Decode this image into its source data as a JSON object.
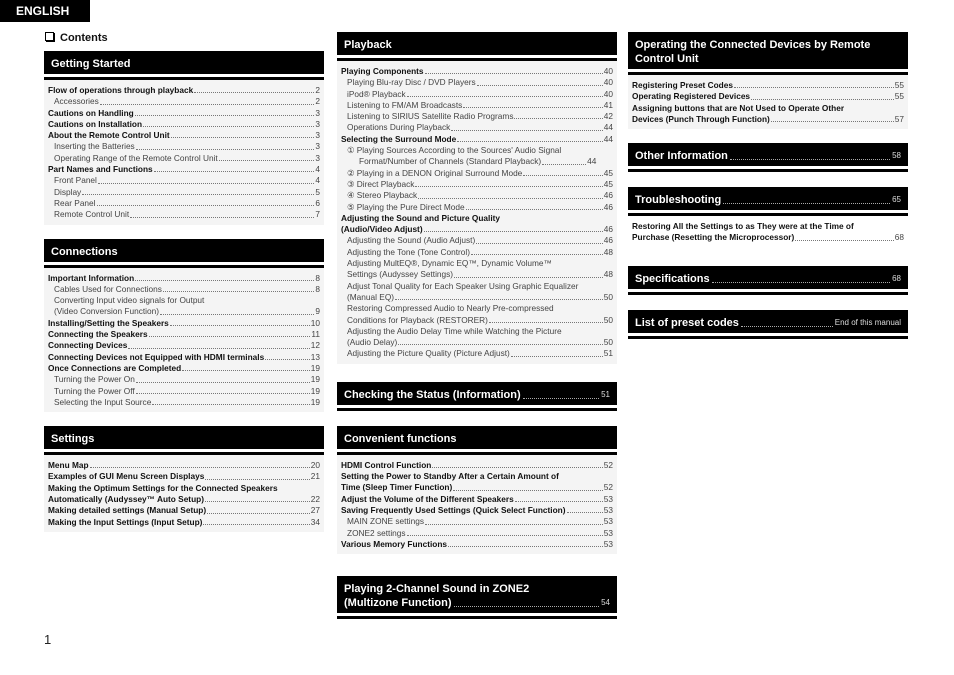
{
  "language_tab": "ENGLISH",
  "contents_title": "Contents",
  "page_number": "1",
  "columns": {
    "col1": {
      "getting_started": {
        "title": "Getting Started",
        "items": [
          {
            "text": "Flow of operations through playback",
            "page": "2",
            "bold": true
          },
          {
            "text": "Accessories",
            "page": "2",
            "bold": false
          },
          {
            "text": "Cautions on Handling",
            "page": "3",
            "bold": true
          },
          {
            "text": "Cautions on Installation",
            "page": "3",
            "bold": true
          },
          {
            "text": "About the Remote Control Unit",
            "page": "3",
            "bold": true
          },
          {
            "text": "Inserting the Batteries",
            "page": "3",
            "bold": false
          },
          {
            "text": "Operating Range of the Remote Control Unit",
            "page": "3",
            "bold": false
          },
          {
            "text": "Part Names and Functions",
            "page": "4",
            "bold": true
          },
          {
            "text": "Front Panel",
            "page": "4",
            "bold": false
          },
          {
            "text": "Display",
            "page": "5",
            "bold": false
          },
          {
            "text": "Rear Panel",
            "page": "6",
            "bold": false
          },
          {
            "text": "Remote Control Unit",
            "page": "7",
            "bold": false
          }
        ]
      },
      "connections": {
        "title": "Connections",
        "items": [
          {
            "text": "Important Information",
            "page": "8",
            "bold": true
          },
          {
            "text": "Cables Used for Connections",
            "page": "8",
            "bold": false
          },
          {
            "text": "Converting Input video signals for Output",
            "page": "",
            "bold": false
          },
          {
            "text": "(Video Conversion Function)",
            "page": "9",
            "bold": false
          },
          {
            "text": "Installing/Setting the Speakers",
            "page": "10",
            "bold": true
          },
          {
            "text": "Connecting the Speakers",
            "page": "11",
            "bold": true
          },
          {
            "text": "Connecting Devices",
            "page": "12",
            "bold": true
          },
          {
            "text": "Connecting Devices not Equipped with HDMI terminals",
            "page": "13",
            "bold": true
          },
          {
            "text": "Once Connections are Completed",
            "page": "19",
            "bold": true
          },
          {
            "text": "Turning the Power On",
            "page": "19",
            "bold": false
          },
          {
            "text": "Turning the Power Off",
            "page": "19",
            "bold": false
          },
          {
            "text": "Selecting the Input Source",
            "page": "19",
            "bold": false
          }
        ]
      },
      "settings": {
        "title": "Settings",
        "items": [
          {
            "text": "Menu Map",
            "page": "20",
            "bold": true
          },
          {
            "text": "Examples of GUI Menu Screen Displays",
            "page": "21",
            "bold": true
          },
          {
            "text": "Making the Optimum Settings for the Connected Speakers",
            "page": "",
            "bold": true
          },
          {
            "text": "Automatically (Audyssey™ Auto Setup)",
            "page": "22",
            "bold": true
          },
          {
            "text": "Making detailed settings (Manual Setup)",
            "page": "27",
            "bold": true
          },
          {
            "text": "Making the Input Settings (Input Setup)",
            "page": "34",
            "bold": true
          }
        ]
      }
    },
    "col2": {
      "playback": {
        "title": "Playback",
        "items": [
          {
            "text": "Playing Components",
            "page": "40",
            "bold": true
          },
          {
            "text": "Playing Blu-ray Disc / DVD Players",
            "page": "40",
            "bold": false
          },
          {
            "text": "iPod® Playback",
            "page": "40",
            "bold": false
          },
          {
            "text": "Listening to FM/AM Broadcasts",
            "page": "41",
            "bold": false
          },
          {
            "text": "Listening to SIRIUS Satellite Radio Programs",
            "page": "42",
            "bold": false
          },
          {
            "text": "Operations During Playback",
            "page": "44",
            "bold": false
          },
          {
            "text": "Selecting the Surround Mode",
            "page": "44",
            "bold": true
          },
          {
            "text": "① Playing Sources According to the Sources' Audio Signal",
            "page": "",
            "bold": false
          },
          {
            "text": "Format/Number of Channels (Standard Playback)",
            "page": "44",
            "bold": false,
            "indent2": true,
            "short": true
          },
          {
            "text": "② Playing in a DENON Original Surround Mode",
            "page": "45",
            "bold": false
          },
          {
            "text": "③ Direct Playback",
            "page": "45",
            "bold": false
          },
          {
            "text": "④ Stereo Playback",
            "page": "46",
            "bold": false
          },
          {
            "text": "⑤ Playing the Pure Direct Mode",
            "page": "46",
            "bold": false
          },
          {
            "text": "Adjusting the Sound and Picture Quality",
            "page": "",
            "bold": true
          },
          {
            "text": "(Audio/Video Adjust)",
            "page": "46",
            "bold": true
          },
          {
            "text": "Adjusting the Sound (Audio Adjust)",
            "page": "46",
            "bold": false
          },
          {
            "text": "Adjusting the Tone (Tone Control)",
            "page": "48",
            "bold": false
          },
          {
            "text": "Adjusting MultEQ®, Dynamic EQ™, Dynamic Volume™",
            "page": "",
            "bold": false
          },
          {
            "text": "Settings (Audyssey Settings)",
            "page": "48",
            "bold": false
          },
          {
            "text": "Adjust Tonal Quality for Each Speaker Using Graphic Equalizer",
            "page": "",
            "bold": false
          },
          {
            "text": "(Manual EQ)",
            "page": "50",
            "bold": false
          },
          {
            "text": "Restoring Compressed Audio to Nearly Pre-compressed",
            "page": "",
            "bold": false
          },
          {
            "text": "Conditions for Playback (RESTORER)",
            "page": "50",
            "bold": false
          },
          {
            "text": "Adjusting the Audio Delay Time while Watching the Picture",
            "page": "",
            "bold": false
          },
          {
            "text": "(Audio Delay)",
            "page": "50",
            "bold": false
          },
          {
            "text": "Adjusting the Picture Quality (Picture Adjust)",
            "page": "51",
            "bold": false
          }
        ]
      },
      "checking_status": {
        "title": "Checking the Status (Information)",
        "page": "51"
      },
      "convenient": {
        "title": "Convenient functions",
        "items": [
          {
            "text": "HDMI Control Function",
            "page": "52",
            "bold": true
          },
          {
            "text": "Setting the Power to Standby After a Certain Amount of",
            "page": "",
            "bold": true
          },
          {
            "text": "Time (Sleep Timer Function)",
            "page": "52",
            "bold": true
          },
          {
            "text": "Adjust the Volume of the Different Speakers",
            "page": "53",
            "bold": true
          },
          {
            "text": "Saving Frequently Used Settings (Quick Select Function)",
            "page": "53",
            "bold": true
          },
          {
            "text": "MAIN ZONE settings",
            "page": "53",
            "bold": false
          },
          {
            "text": "ZONE2 settings",
            "page": "53",
            "bold": false
          },
          {
            "text": "Various Memory Functions",
            "page": "53",
            "bold": true
          }
        ]
      },
      "zone2": {
        "title_line1": "Playing 2-Channel Sound in ZONE2",
        "title_line2": "(Multizone Function)",
        "page": "54"
      }
    },
    "col3": {
      "operating": {
        "title": "Operating the Connected Devices by Remote Control Unit",
        "items": [
          {
            "text": "Registering Preset Codes",
            "page": "55",
            "bold": true
          },
          {
            "text": "Operating Registered Devices",
            "page": "55",
            "bold": true
          },
          {
            "text": "Assigning buttons that are Not Used to Operate Other",
            "page": "",
            "bold": true
          },
          {
            "text": "Devices (Punch Through Function)",
            "page": "57",
            "bold": true
          }
        ]
      },
      "other_info": {
        "title": "Other Information",
        "page": "58"
      },
      "troubleshooting": {
        "title": "Troubleshooting",
        "page": "65",
        "items": [
          {
            "text": "Restoring All the Settings to as They were at the Time of",
            "page": "",
            "bold": true
          },
          {
            "text": "Purchase (Resetting the Microprocessor)",
            "page": "68",
            "bold": true
          }
        ]
      },
      "specifications": {
        "title": "Specifications",
        "page": "68"
      },
      "preset_codes": {
        "title": "List of preset codes",
        "page": "End of this manual"
      }
    }
  }
}
